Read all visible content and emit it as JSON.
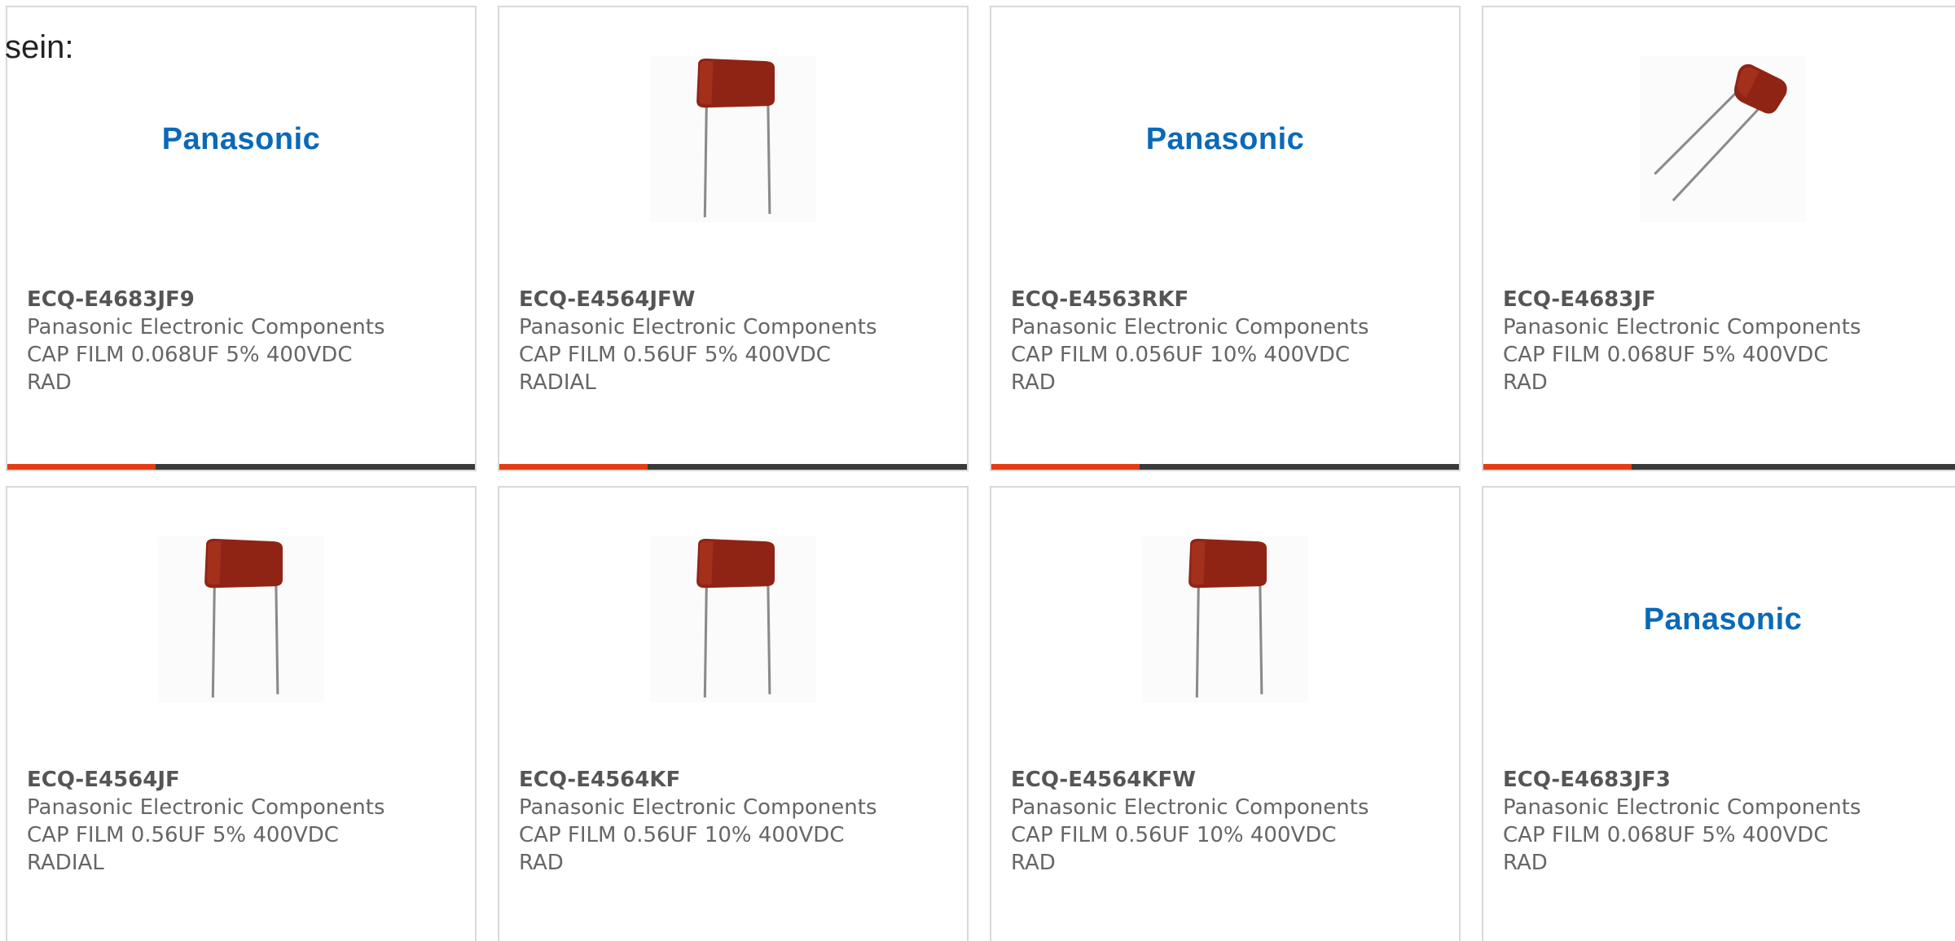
{
  "intro_text": "sein:",
  "brand_logo_text": "Panasonic",
  "colors": {
    "logo_blue": "#0a69b8",
    "accent_red": "#e43c14",
    "bar_dark": "#3a3a3a",
    "capacitor_body": "#8f2415",
    "text_gray": "#666666"
  },
  "products": [
    {
      "part_number": "ECQ-E4683JF9",
      "manufacturer": "Panasonic Electronic Components",
      "desc_line1": "CAP FILM 0.068UF 5% 400VDC",
      "desc_line2": "RAD",
      "image": "panasonic-logo"
    },
    {
      "part_number": "ECQ-E4564JFW",
      "manufacturer": "Panasonic Electronic Components",
      "desc_line1": "CAP FILM 0.56UF 5% 400VDC",
      "desc_line2": "RADIAL",
      "image": "film-capacitor-upright"
    },
    {
      "part_number": "ECQ-E4563RKF",
      "manufacturer": "Panasonic Electronic Components",
      "desc_line1": "CAP FILM 0.056UF 10% 400VDC",
      "desc_line2": "RAD",
      "image": "panasonic-logo"
    },
    {
      "part_number": "ECQ-E4683JF",
      "manufacturer": "Panasonic Electronic Components",
      "desc_line1": "CAP FILM 0.068UF 5% 400VDC",
      "desc_line2": "RAD",
      "image": "film-capacitor-angled"
    },
    {
      "part_number": "ECQ-E4564JF",
      "manufacturer": "Panasonic Electronic Components",
      "desc_line1": "CAP FILM 0.56UF 5% 400VDC",
      "desc_line2": "RADIAL",
      "image": "film-capacitor-upright"
    },
    {
      "part_number": "ECQ-E4564KF",
      "manufacturer": "Panasonic Electronic Components",
      "desc_line1": "CAP FILM 0.56UF 10% 400VDC",
      "desc_line2": "RAD",
      "image": "film-capacitor-upright"
    },
    {
      "part_number": "ECQ-E4564KFW",
      "manufacturer": "Panasonic Electronic Components",
      "desc_line1": "CAP FILM 0.56UF 10% 400VDC",
      "desc_line2": "RAD",
      "image": "film-capacitor-upright"
    },
    {
      "part_number": "ECQ-E4683JF3",
      "manufacturer": "Panasonic Electronic Components",
      "desc_line1": "CAP FILM 0.068UF 5% 400VDC",
      "desc_line2": "RAD",
      "image": "panasonic-logo"
    }
  ]
}
